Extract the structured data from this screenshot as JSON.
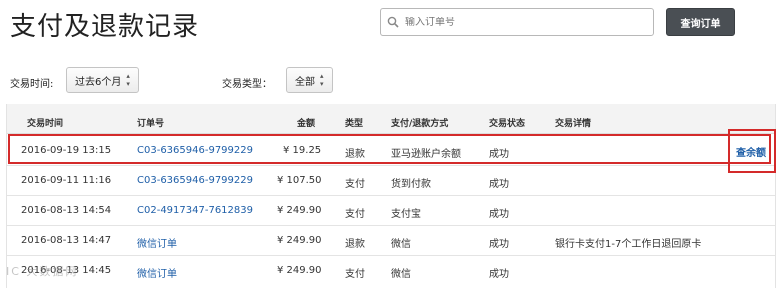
{
  "page_title": "支付及退款记录",
  "search": {
    "placeholder": "输入订单号",
    "button_label": "查询订单"
  },
  "filters": {
    "time_label": "交易时间:",
    "time_value": "过去6个月",
    "type_label": "交易类型：",
    "type_value": "全部"
  },
  "table": {
    "headers": [
      "交易时间",
      "订单号",
      "金额",
      "类型",
      "支付/退款方式",
      "交易状态",
      "交易详情"
    ],
    "rows": [
      {
        "time": "2016-09-19 13:15",
        "order": "C03-6365946-9799229",
        "amount": "¥ 19.25",
        "type": "退款",
        "method": "亚马逊账户余额",
        "status": "成功",
        "detail": ""
      },
      {
        "time": "2016-09-11 11:16",
        "order": "C03-6365946-9799229",
        "amount": "¥ 107.50",
        "type": "支付",
        "method": "货到付款",
        "status": "成功",
        "detail": ""
      },
      {
        "time": "2016-08-13 14:54",
        "order": "C02-4917347-7612839",
        "amount": "¥ 249.90",
        "type": "支付",
        "method": "支付宝",
        "status": "成功",
        "detail": ""
      },
      {
        "time": "2016-08-13 14:47",
        "order": "微信订单",
        "amount": "¥ 249.90",
        "type": "退款",
        "method": "微信",
        "status": "成功",
        "detail": "银行卡支付1-7个工作日退回原卡"
      },
      {
        "time": "2016-08-13 14:45",
        "order": "微信订单",
        "amount": "¥ 249.90",
        "type": "支付",
        "method": "微信",
        "status": "成功",
        "detail": ""
      }
    ]
  },
  "row_action": "查余额",
  "watermark": "IC 大数据网",
  "colors": {
    "highlight": "#d42a2a",
    "link": "#1f5fa8",
    "button": "#4a4f54"
  },
  "icons": [
    "search-icon",
    "chevron-updown-icon"
  ]
}
